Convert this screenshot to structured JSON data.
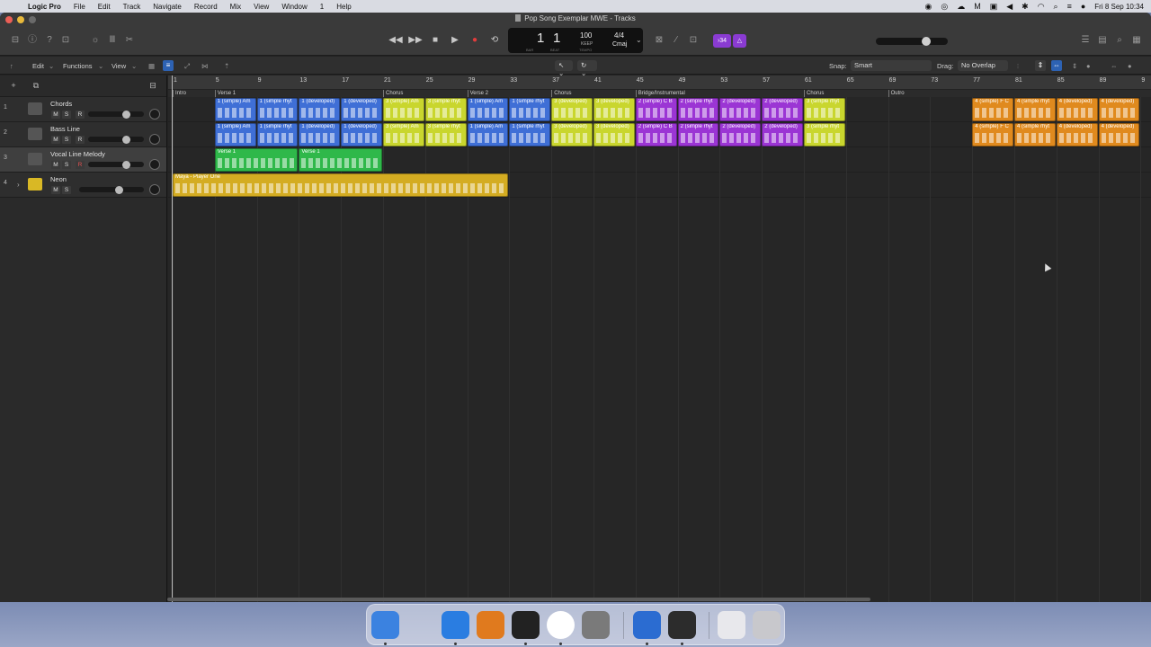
{
  "menubar": {
    "app": "Logic Pro",
    "items": [
      "File",
      "Edit",
      "Track",
      "Navigate",
      "Record",
      "Mix",
      "View",
      "Window",
      "1",
      "Help"
    ],
    "datetime": "Fri 8 Sep  10:34"
  },
  "window": {
    "title": "Pop Song Exemplar MWE - Tracks"
  },
  "lcd": {
    "bar": "1",
    "beat": "1",
    "bar_label": "BAR",
    "beat_label": "BEAT",
    "tempo": "100",
    "tempo_mode": "KEEP",
    "tempo_label": "TEMPO",
    "signature": "4/4",
    "key": "Cmaj"
  },
  "control": {
    "count_in": "›34"
  },
  "toolbar": {
    "edit": "Edit",
    "functions": "Functions",
    "view": "View",
    "snap_label": "Snap:",
    "snap_value": "Smart",
    "drag_label": "Drag:",
    "drag_value": "No Overlap"
  },
  "tracks": [
    {
      "num": "1",
      "name": "Chords"
    },
    {
      "num": "2",
      "name": "Bass Line"
    },
    {
      "num": "3",
      "name": "Vocal Line Melody"
    },
    {
      "num": "4",
      "name": "Neon"
    }
  ],
  "buttons": {
    "mute": "M",
    "solo": "S",
    "record": "R"
  },
  "ruler": [
    "1",
    "5",
    "9",
    "13",
    "17",
    "21",
    "25",
    "29",
    "33",
    "37",
    "41",
    "45",
    "49",
    "53",
    "57",
    "61",
    "65",
    "69",
    "73",
    "77",
    "81",
    "85",
    "89",
    "9"
  ],
  "markers": [
    {
      "label": "Intro"
    },
    {
      "label": "Verse 1"
    },
    {
      "label": "Chorus"
    },
    {
      "label": "Verse 2"
    },
    {
      "label": "Chorus"
    },
    {
      "label": "Bridge/Instrumental"
    },
    {
      "label": "Chorus"
    },
    {
      "label": "Outro"
    }
  ],
  "regions": {
    "chords": [
      {
        "name": "1 (simple) Am",
        "color": "#3f6fd6"
      },
      {
        "name": "1 (simple rhyt",
        "color": "#3f6fd6"
      },
      {
        "name": "1 (developed)",
        "color": "#3f6fd6"
      },
      {
        "name": "1 (developed)",
        "color": "#3f6fd6"
      },
      {
        "name": "3 (simple) Am",
        "color": "#c9d62e"
      },
      {
        "name": "3 (simple rhyt",
        "color": "#c9d62e"
      },
      {
        "name": "1 (simple) Am",
        "color": "#3f6fd6"
      },
      {
        "name": "1 (simple rhyt",
        "color": "#3f6fd6"
      },
      {
        "name": "3 (developed)",
        "color": "#c9d62e"
      },
      {
        "name": "3 (developed)",
        "color": "#c9d62e"
      },
      {
        "name": "2 (simple) C B",
        "color": "#9b35d4"
      },
      {
        "name": "2 (simple rhyt",
        "color": "#9b35d4"
      },
      {
        "name": "2 (developed)",
        "color": "#9b35d4"
      },
      {
        "name": "2 (developed)",
        "color": "#9b35d4"
      },
      {
        "name": "3 (simple rhyt",
        "color": "#c9d62e"
      },
      {
        "name": "4 (simple) F C",
        "color": "#e08a1e"
      },
      {
        "name": "4 (simple rhyt",
        "color": "#e08a1e"
      },
      {
        "name": "4 (developed)",
        "color": "#e08a1e"
      },
      {
        "name": "4 (developed)",
        "color": "#e08a1e"
      }
    ],
    "bass": [
      {
        "name": "1 (simple) Am",
        "color": "#3f6fd6"
      },
      {
        "name": "1 (simple rhyt",
        "color": "#3f6fd6"
      },
      {
        "name": "1 (developed)",
        "color": "#3f6fd6"
      },
      {
        "name": "1 (developed)",
        "color": "#3f6fd6"
      },
      {
        "name": "3 (simple) Am",
        "color": "#c9d62e"
      },
      {
        "name": "3 (simple rhyt",
        "color": "#c9d62e"
      },
      {
        "name": "1 (simple) Am",
        "color": "#3f6fd6"
      },
      {
        "name": "1 (simple rhyt",
        "color": "#3f6fd6"
      },
      {
        "name": "3 (developed)",
        "color": "#c9d62e"
      },
      {
        "name": "3 (developed)",
        "color": "#c9d62e"
      },
      {
        "name": "2 (simple) C B",
        "color": "#9b35d4"
      },
      {
        "name": "2 (simple rhyt",
        "color": "#9b35d4"
      },
      {
        "name": "2 (developed)",
        "color": "#9b35d4"
      },
      {
        "name": "2 (developed)",
        "color": "#9b35d4"
      },
      {
        "name": "3 (simple rhyt",
        "color": "#c9d62e"
      },
      {
        "name": "4 (simple) F C",
        "color": "#e08a1e"
      },
      {
        "name": "4 (simple rhyt",
        "color": "#e08a1e"
      },
      {
        "name": "4 (developed)",
        "color": "#e08a1e"
      },
      {
        "name": "4 (developed)",
        "color": "#e08a1e"
      }
    ],
    "vocal": [
      {
        "name": "Verse 1",
        "color": "#2fb84a"
      },
      {
        "name": "Verse 1",
        "color": "#2fb84a"
      }
    ],
    "audio": [
      {
        "name": "Maya - Player One",
        "color": "#d4ac22"
      }
    ]
  },
  "dock": [
    "finder-icon",
    "help-icon",
    "safari-icon",
    "garageband-icon",
    "logic-pro-icon",
    "chrome-icon",
    "system-settings-icon",
    "onedrive-icon",
    "quicktime-icon",
    "music-icon",
    "trash-icon"
  ]
}
